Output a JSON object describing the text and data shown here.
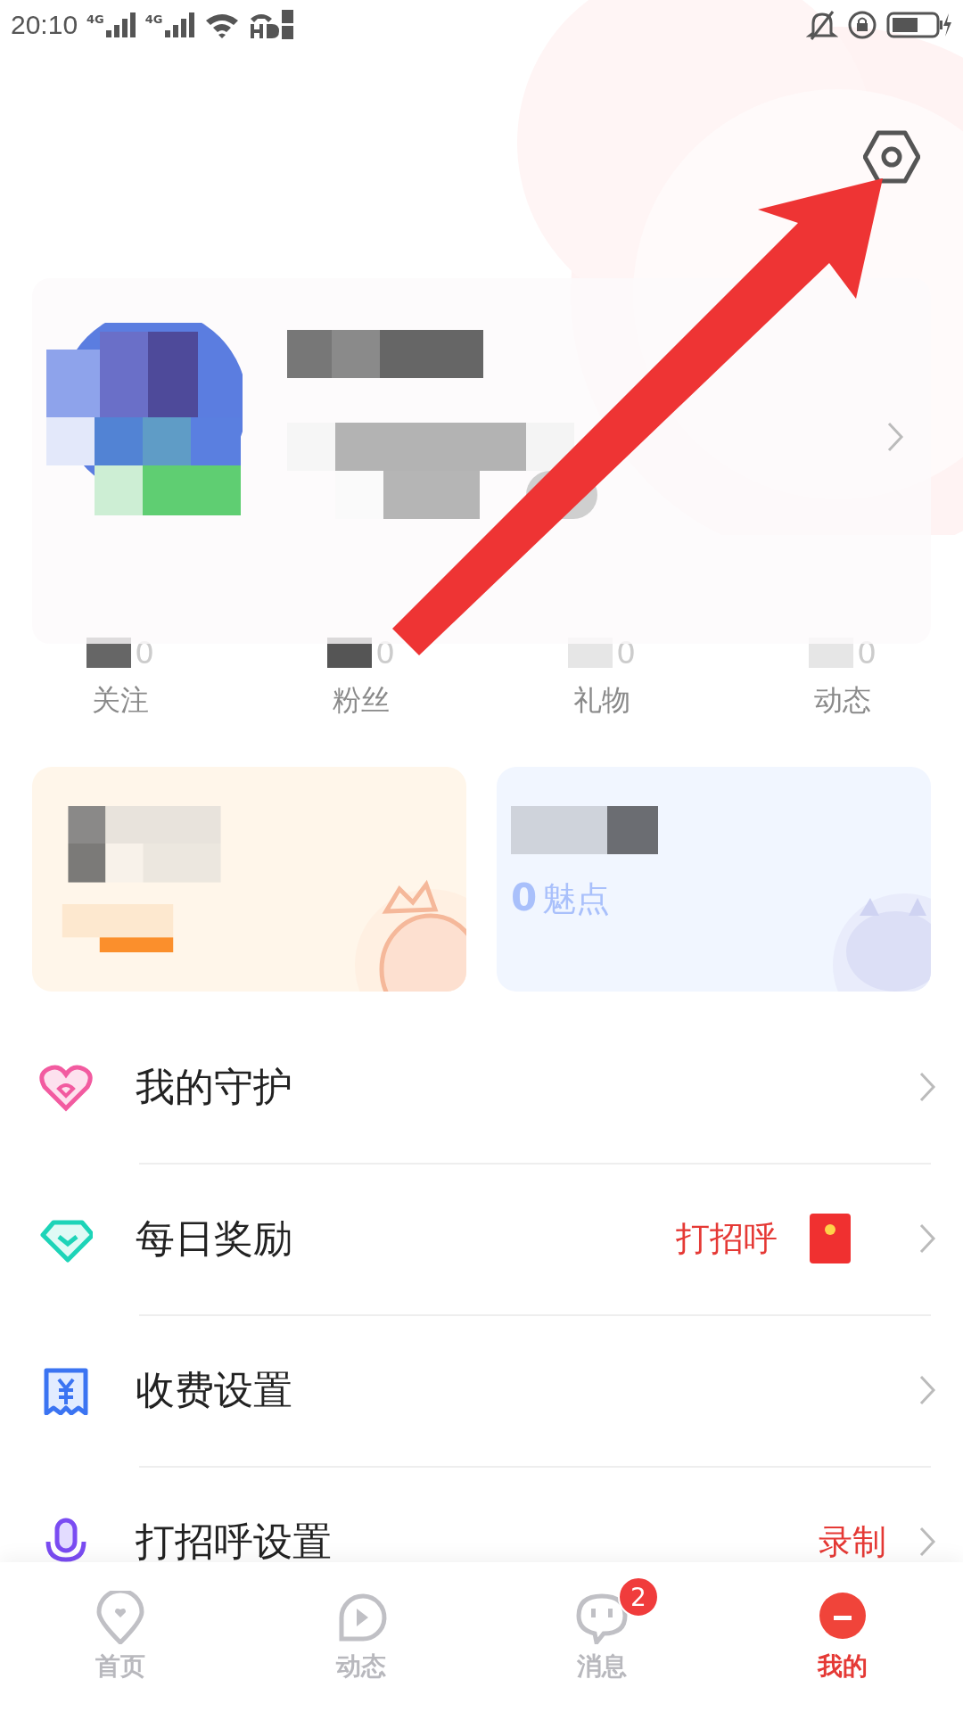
{
  "status_bar": {
    "time": "20:10",
    "sim_1": "4G",
    "sim_2": "4G"
  },
  "profile": {
    "stats": [
      {
        "value": "0",
        "label": "关注"
      },
      {
        "value": "0",
        "label": "粉丝"
      },
      {
        "value": "0",
        "label": "礼物"
      },
      {
        "value": "0",
        "label": "动态"
      }
    ]
  },
  "wallet_cards": [
    {
      "kind": "recharge"
    },
    {
      "kind": "earnings",
      "amount": "0",
      "unit": "魅点"
    }
  ],
  "menu": [
    {
      "kind": "heart",
      "label": "我的守护"
    },
    {
      "kind": "diamond",
      "label": "每日奖励",
      "action": "打招呼",
      "envelope": true
    },
    {
      "kind": "yen",
      "label": "收费设置"
    },
    {
      "kind": "mic",
      "label": "打招呼设置",
      "action": "录制"
    }
  ],
  "tab_bar": [
    {
      "kind": "home",
      "label": "首页",
      "selected": false
    },
    {
      "kind": "feed",
      "label": "动态",
      "selected": false
    },
    {
      "kind": "message",
      "label": "消息",
      "selected": false,
      "badge": "2"
    },
    {
      "kind": "me",
      "label": "我的",
      "selected": true
    }
  ]
}
